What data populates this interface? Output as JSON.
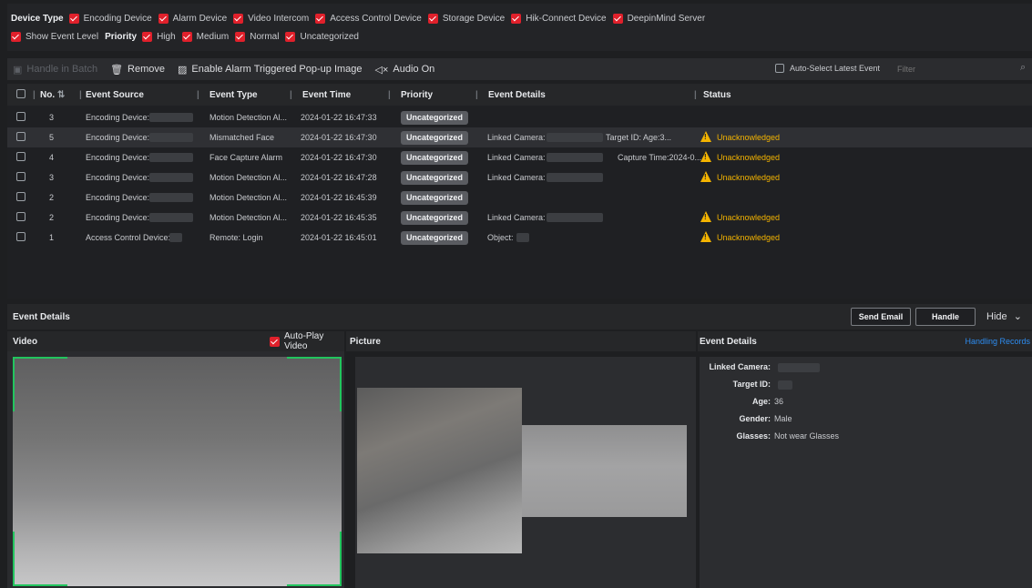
{
  "filters": {
    "device_type_label": "Device Type",
    "device_types": [
      "Encoding Device",
      "Alarm Device",
      "Video Intercom",
      "Access Control Device",
      "Storage Device",
      "Hik-Connect Device",
      "DeepinMind Server"
    ],
    "show_event_level": "Show Event Level",
    "priority_label": "Priority",
    "priorities": [
      "High",
      "Medium",
      "Normal",
      "Uncategorized"
    ]
  },
  "toolbar": {
    "handle_batch": "Handle in Batch",
    "remove": "Remove",
    "enable_popup": "Enable Alarm Triggered Pop-up Image",
    "audio_on": "Audio On",
    "auto_select": "Auto-Select Latest Event",
    "filter_placeholder": "Filter"
  },
  "table": {
    "headers": {
      "no": "No.",
      "source": "Event Source",
      "type": "Event Type",
      "time": "Event Time",
      "priority": "Priority",
      "details": "Event Details",
      "status": "Status"
    },
    "rows": [
      {
        "no": "3",
        "source": "Encoding Device:",
        "type": "Motion Detection Al...",
        "time": "2024-01-22 16:47:33",
        "priority": "Uncategorized",
        "details": "",
        "details2": "",
        "status": ""
      },
      {
        "no": "5",
        "source": "Encoding Device:",
        "type": "Mismatched Face",
        "time": "2024-01-22 16:47:30",
        "priority": "Uncategorized",
        "details": "Linked Camera:",
        "details2": "Target ID:       Age:3...",
        "status": "Unacknowledged"
      },
      {
        "no": "4",
        "source": "Encoding Device:",
        "type": "Face Capture Alarm",
        "time": "2024-01-22 16:47:30",
        "priority": "Uncategorized",
        "details": "Linked Camera:",
        "details2": "Capture Time:2024-0...",
        "status": "Unacknowledged"
      },
      {
        "no": "3",
        "source": "Encoding Device:",
        "type": "Motion Detection Al...",
        "time": "2024-01-22 16:47:28",
        "priority": "Uncategorized",
        "details": "Linked Camera:",
        "details2": "",
        "status": "Unacknowledged"
      },
      {
        "no": "2",
        "source": "Encoding Device:",
        "type": "Motion Detection Al...",
        "time": "2024-01-22 16:45:39",
        "priority": "Uncategorized",
        "details": "",
        "details2": "",
        "status": ""
      },
      {
        "no": "2",
        "source": "Encoding Device:",
        "type": "Motion Detection Al...",
        "time": "2024-01-22 16:45:35",
        "priority": "Uncategorized",
        "details": "Linked Camera:",
        "details2": "",
        "status": "Unacknowledged"
      },
      {
        "no": "1",
        "source": "Access Control Device:",
        "type": "Remote: Login",
        "time": "2024-01-22 16:45:01",
        "priority": "Uncategorized",
        "details": "Object:",
        "details2": "",
        "status": "Unacknowledged"
      }
    ]
  },
  "event_details_bar": {
    "title": "Event Details",
    "send_email": "Send Email",
    "handle": "Handle",
    "hide": "Hide"
  },
  "video": {
    "title": "Video",
    "auto_play": "Auto-Play Video"
  },
  "picture": {
    "title": "Picture"
  },
  "details_panel": {
    "title": "Event Details",
    "handling_records": "Handling Records",
    "fields": [
      {
        "label": "Linked Camera:",
        "value": ""
      },
      {
        "label": "Target ID:",
        "value": ""
      },
      {
        "label": "Age:",
        "value": "36"
      },
      {
        "label": "Gender:",
        "value": "Male"
      },
      {
        "label": "Glasses:",
        "value": "Not wear Glasses"
      }
    ]
  },
  "colors": {
    "accent_red": "#e0202b",
    "warning": "#f4b400",
    "link": "#2d8cf0",
    "frame_green": "#22c55e"
  }
}
